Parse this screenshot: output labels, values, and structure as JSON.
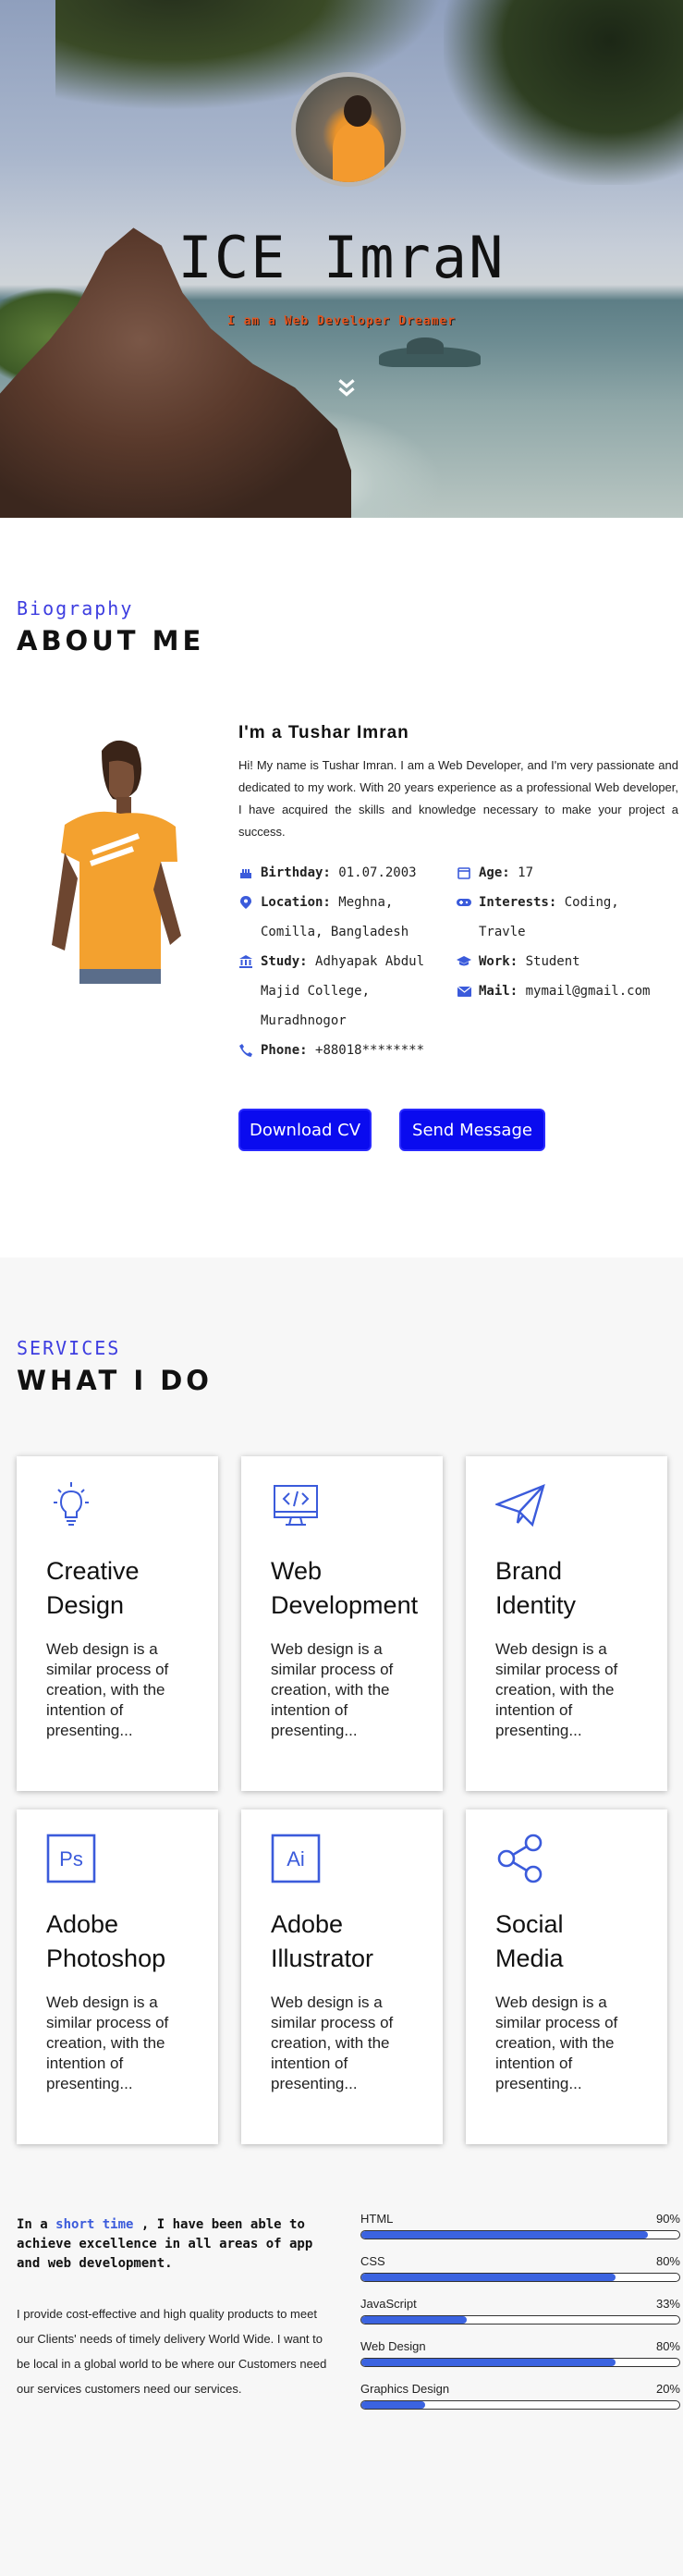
{
  "hero": {
    "title": "ICE ImraN",
    "subtitle": "I am a Web Developer Dreamer"
  },
  "about": {
    "label": "Biography",
    "title": "ABOUT ME",
    "name": "I'm a Tushar Imran",
    "bio": "Hi! My name is Tushar Imran. I am a Web Developer, and I'm very passionate and dedicated to my work. With 20 years experience as a professional Web developer, I have acquired the skills and knowledge necessary to make your project a success.",
    "facts": {
      "birthday_label": "Birthday:",
      "birthday": "01.07.2003",
      "age_label": "Age:",
      "age": "17",
      "location_label": "Location:",
      "location_1": "Meghna,",
      "location_2": "Comilla, Bangladesh",
      "interests_label": "Interests:",
      "interests_1": "Coding,",
      "interests_2": "Travle",
      "study_label": "Study:",
      "study_1": "Adhyapak Abdul",
      "study_2": "Majid College,",
      "study_3": "Muradhnogor",
      "work_label": "Work:",
      "work": "Student",
      "mail_label": "Mail:",
      "mail": "mymail@gmail.com",
      "phone_label": "Phone:",
      "phone": "+88018********"
    },
    "buttons": {
      "download": "Download CV",
      "message": "Send Message"
    }
  },
  "services": {
    "label": "SERVICES",
    "title": "WHAT I DO",
    "cards": [
      {
        "icon": "lightbulb-icon",
        "title_1": "Creative",
        "title_2": "Design",
        "desc": "Web design is a similar process of creation, with the intention of presenting..."
      },
      {
        "icon": "code-monitor-icon",
        "title_1": "Web",
        "title_2": "Development",
        "desc": "Web design is a similar process of creation, with the intention of presenting..."
      },
      {
        "icon": "paper-plane-icon",
        "title_1": "Brand",
        "title_2": "Identity",
        "desc": "Web design is a similar process of creation, with the intention of presenting..."
      },
      {
        "icon": "photoshop-icon",
        "badge": "Ps",
        "title_1": "Adobe",
        "title_2": "Photoshop",
        "desc": "Web design is a similar process of creation, with the intention of presenting..."
      },
      {
        "icon": "illustrator-icon",
        "badge": "Ai",
        "title_1": "Adobe",
        "title_2": "Illustrator",
        "desc": "Web design is a similar process of creation, with the intention of presenting..."
      },
      {
        "icon": "share-icon",
        "title_1": "Social Media",
        "title_2": "",
        "desc": "Web design is a similar process of creation, with the intention of presenting..."
      }
    ]
  },
  "skills": {
    "lead_1": "In a ",
    "lead_hl": "short time",
    "lead_2": " , I have been able to achieve excellence in all areas of app and web development.",
    "para": "I provide cost-effective and high quality products to meet our Clients' needs of timely delivery World Wide. I want to be local in a global world to be where our Customers need our services customers need our services.",
    "items": [
      {
        "name": "HTML",
        "percent_label": "90%",
        "value": 90
      },
      {
        "name": "CSS",
        "percent_label": "80%",
        "value": 80
      },
      {
        "name": "JavaScript",
        "percent_label": "33%",
        "value": 33
      },
      {
        "name": "Web Design",
        "percent_label": "80%",
        "value": 80
      },
      {
        "name": "Graphics Design",
        "percent_label": "20%",
        "value": 20
      }
    ]
  },
  "colors": {
    "accent": "#3b5bdb",
    "button": "#0a0bef",
    "label": "#3d3de0",
    "subtitle": "#e3551f"
  }
}
